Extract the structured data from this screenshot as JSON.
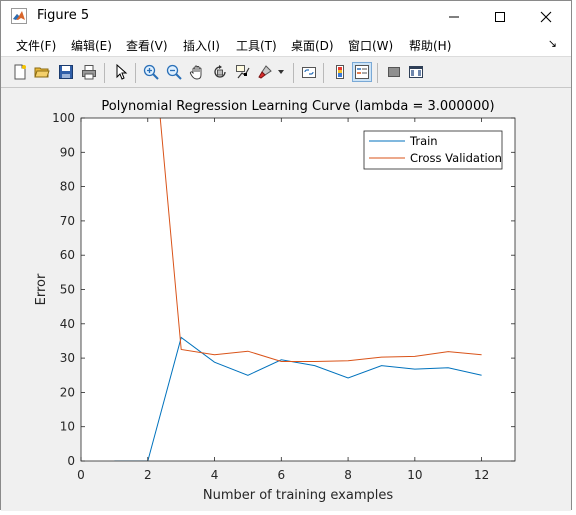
{
  "window": {
    "title": "Figure 5"
  },
  "menu": {
    "items": [
      "文件(F)",
      "编辑(E)",
      "查看(V)",
      "插入(I)",
      "工具(T)",
      "桌面(D)",
      "窗口(W)",
      "帮助(H)"
    ],
    "overflow_arrow": "↘"
  },
  "toolbar": {
    "icons": [
      "new-figure-icon",
      "open-file-icon",
      "save-icon",
      "print-icon",
      "pointer-icon",
      "zoom-in-icon",
      "zoom-out-icon",
      "pan-hand-icon",
      "rotate-3d-icon",
      "data-cursor-icon",
      "brush-icon",
      "link-plot-icon",
      "colorbar-icon",
      "legend-icon",
      "hide-plot-tools-icon",
      "show-plot-tools-icon"
    ]
  },
  "chart_data": {
    "type": "line",
    "title": "Polynomial Regression Learning Curve (lambda = 3.000000)",
    "xlabel": "Number of training examples",
    "ylabel": "Error",
    "xlim": [
      0,
      13
    ],
    "ylim": [
      0,
      100
    ],
    "xticks": [
      0,
      2,
      4,
      6,
      8,
      10,
      12
    ],
    "yticks": [
      0,
      10,
      20,
      30,
      40,
      50,
      60,
      70,
      80,
      90,
      100
    ],
    "legend_position": "top-right",
    "series": [
      {
        "name": "Train",
        "color": "#0072bd",
        "x": [
          1,
          2,
          3,
          4,
          5,
          6,
          7,
          8,
          9,
          10,
          11,
          12
        ],
        "y": [
          0,
          0,
          36.0,
          28.8,
          25.0,
          29.5,
          27.8,
          24.2,
          27.8,
          26.8,
          27.2,
          25.0
        ]
      },
      {
        "name": "Cross Validation",
        "color": "#d95319",
        "x": [
          1,
          2,
          3,
          4,
          5,
          6,
          7,
          8,
          9,
          10,
          11,
          12
        ],
        "y": [
          160.0,
          140.0,
          32.5,
          31.0,
          32.0,
          29.0,
          29.0,
          29.2,
          30.3,
          30.5,
          31.9,
          31.0
        ]
      }
    ]
  },
  "background": {
    "left_char": "e",
    "bottom_char": "0"
  },
  "colors": {
    "window_bg": "#f0f0f0",
    "axes_bg": "#ffffff",
    "accent_train": "#0072bd",
    "accent_cv": "#d95319"
  }
}
